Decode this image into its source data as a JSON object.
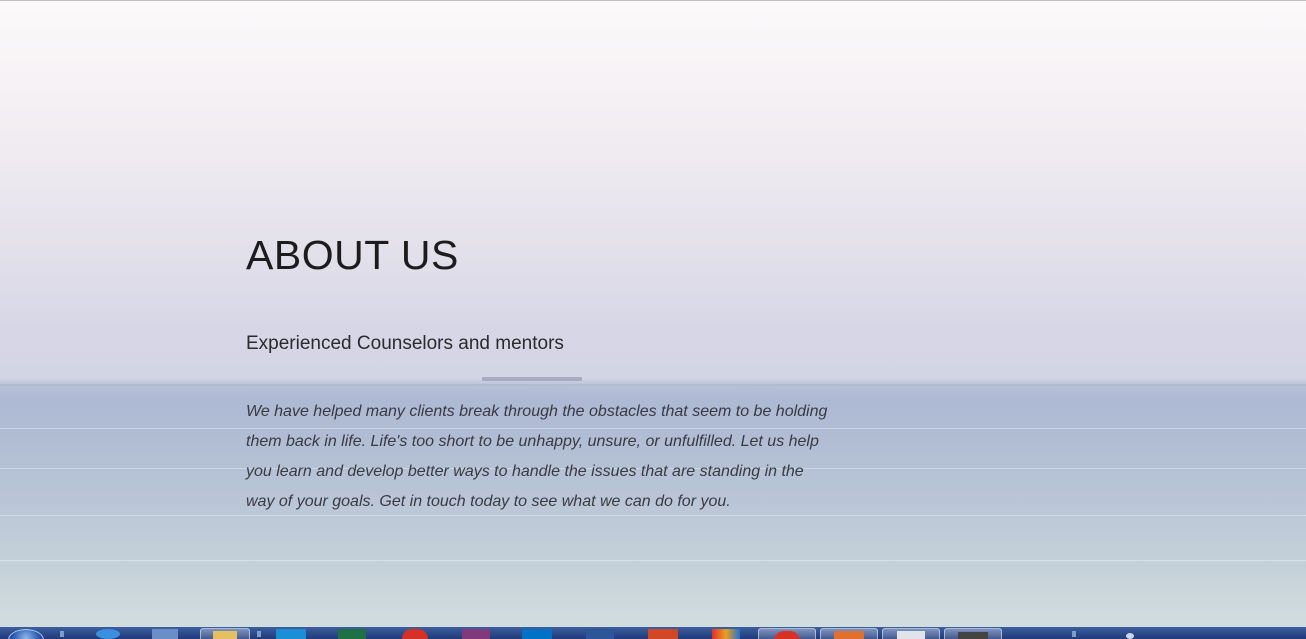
{
  "about": {
    "heading": "ABOUT US",
    "subheading": "Experienced Counselors and mentors",
    "body": "We have helped many clients break through the obstacles that seem to be holding them back in life. Life's too short to be unhappy, unsure, or unfulfilled. Let us help you learn and develop better ways to handle the issues that are standing in the way of your goals. Get in touch today to see what we can do for you."
  },
  "taskbar": {
    "items": [
      {
        "icon": "start-orb-icon",
        "color": "#2a5bb0"
      },
      {
        "icon": "internet-explorer-icon",
        "color": "#3b8fe0"
      },
      {
        "icon": "windows-explorer-icon",
        "color": "#6a8fc8"
      },
      {
        "icon": "file-explorer-icon",
        "color": "#e5c060"
      },
      {
        "icon": "hp-icon",
        "color": "#1a8fd8"
      },
      {
        "icon": "excel-icon",
        "color": "#1e7145"
      },
      {
        "icon": "chrome-icon",
        "color": "#d93025"
      },
      {
        "icon": "onenote-icon",
        "color": "#80397b"
      },
      {
        "icon": "outlook-icon",
        "color": "#0072c6"
      },
      {
        "icon": "word-icon",
        "color": "#2b579a"
      },
      {
        "icon": "powerpoint-icon",
        "color": "#d24726"
      },
      {
        "icon": "multicolor-app-icon",
        "color": "#e8a020"
      },
      {
        "icon": "chrome-active-icon",
        "color": "#d93025"
      },
      {
        "icon": "powerpoint-window-icon",
        "color": "#e07030"
      },
      {
        "icon": "notepad-icon",
        "color": "#e0e4ea"
      },
      {
        "icon": "dark-app-icon",
        "color": "#444444"
      }
    ]
  }
}
